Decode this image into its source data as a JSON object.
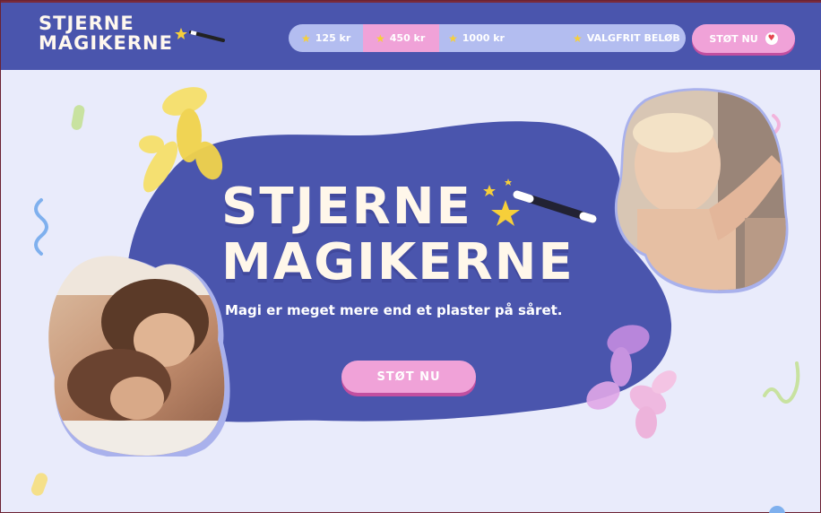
{
  "header": {
    "logo_line1": "STJERNE",
    "logo_line2": "MAGIKERNE",
    "amounts": [
      {
        "label": "125 kr",
        "selected": false
      },
      {
        "label": "450 kr",
        "selected": true
      },
      {
        "label": "1000 kr",
        "selected": false
      },
      {
        "label": "VALGFRIT BELØB",
        "selected": false
      }
    ],
    "cta_label": "STØT NU"
  },
  "hero": {
    "title_line1": "STJERNE",
    "title_line2": "MAGIKERNE",
    "tagline": "Magi er meget mere end et plaster på såret.",
    "cta_label": "STØT NU"
  },
  "colors": {
    "header_bg": "#4a55ad",
    "page_bg": "#e9ebfb",
    "accent_pink": "#f0a2d8",
    "amount_bar": "#b3bdf0",
    "star_yellow": "#f6cf3a",
    "title_cream": "#fff7ea"
  },
  "icons": [
    "star-icon",
    "magic-wand-icon",
    "heart-icon",
    "balloon-dog-yellow",
    "balloon-dog-pink"
  ]
}
